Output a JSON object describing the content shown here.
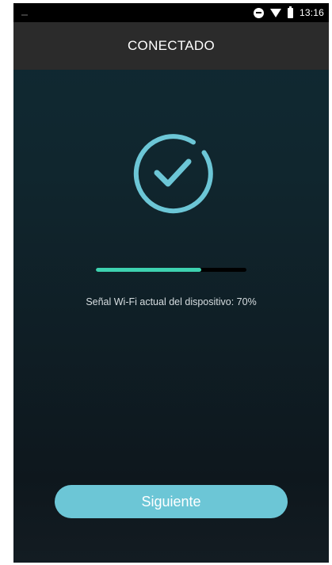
{
  "status_bar": {
    "time": "13:16",
    "icons": [
      "do-not-disturb-icon",
      "wifi-icon",
      "battery-icon"
    ]
  },
  "header": {
    "title": "CONECTADO"
  },
  "main": {
    "status_icon": "check-circle-icon",
    "signal": {
      "level_percent": 70,
      "text": "Señal Wi-Fi actual del dispositivo: 70%"
    },
    "next_button_label": "Siguiente"
  },
  "colors": {
    "accent": "#6cc6d6",
    "signal_fill": "#3ed2b0",
    "app_bar": "#2b2b2b",
    "background_top": "#0f2a33",
    "background_bottom": "#0e171d"
  }
}
